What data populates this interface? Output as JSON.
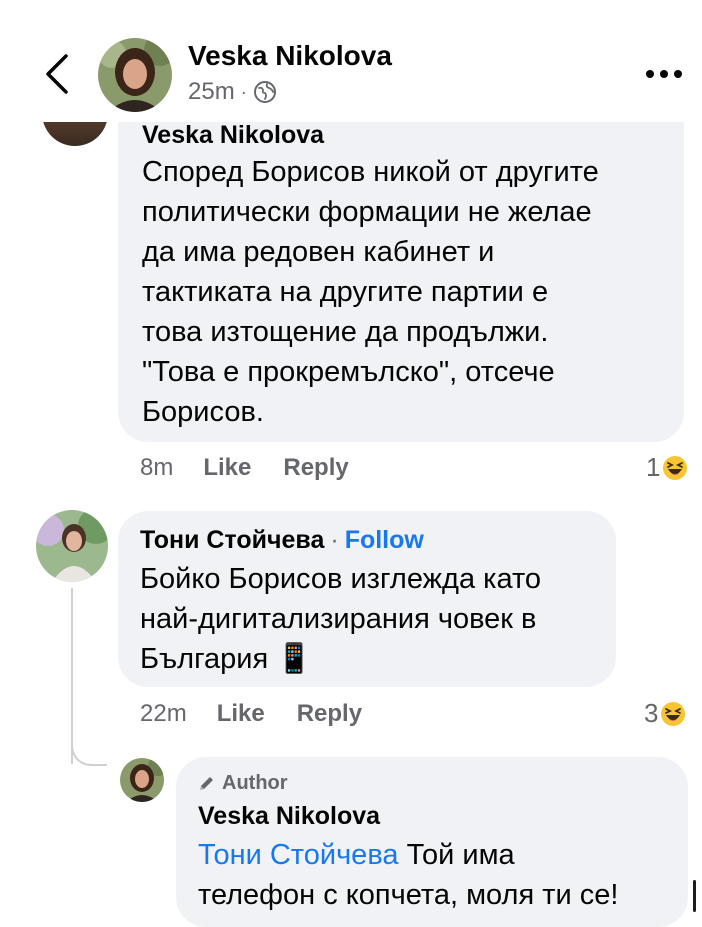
{
  "header": {
    "name": "Veska Nikolova",
    "time": "25m",
    "dot": "·"
  },
  "comments": [
    {
      "author": "Veska Nikolova",
      "lines": [
        "Според Борисов никой от другите",
        "политически формации не желае",
        "да има редовен кабинет и",
        "тактиката на другите партии е",
        "това изтощение да продължи.",
        "\"Това е прокремълско\", отсече",
        "Борисов."
      ],
      "time": "8m",
      "like_label": "Like",
      "reply_label": "Reply",
      "reaction_count": "1"
    },
    {
      "author": "Тони Стойчева",
      "separator": "·",
      "follow_label": "Follow",
      "lines": [
        "Бойко Борисов изглежда като",
        "най-дигитализирания човек в",
        "България 📱"
      ],
      "time": "22m",
      "like_label": "Like",
      "reply_label": "Reply",
      "reaction_count": "3"
    },
    {
      "badge": "Author",
      "author": "Veska Nikolova",
      "mention": "Тони Стойчева",
      "line1_rest": " Той има",
      "line2": "телефон с копчета, моля ти се!"
    }
  ],
  "icons": {
    "back": "chevron-left-icon",
    "globe": "globe-icon",
    "more": "more-horizontal-icon",
    "reaction": "haha-icon",
    "author_badge": "pen-icon"
  },
  "colors": {
    "bubble": "#f0f2f5",
    "link": "#1877f2",
    "muted": "#65676b",
    "text": "#050505"
  }
}
